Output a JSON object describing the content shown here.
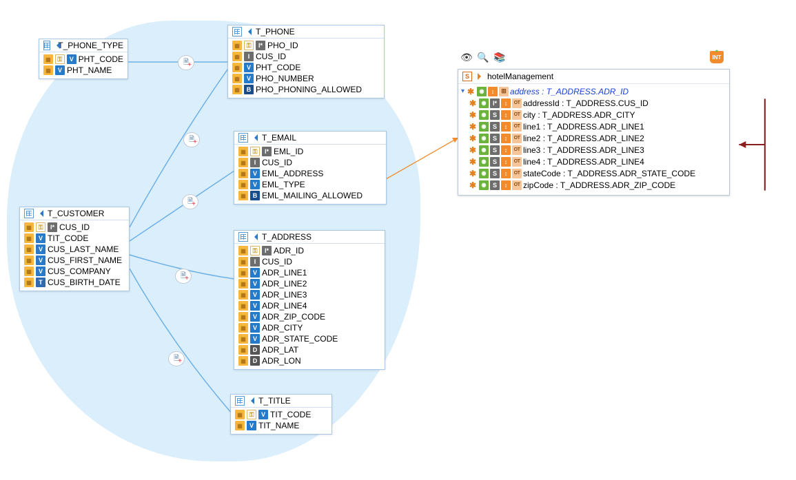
{
  "entities": {
    "phone": {
      "title": "T_PHONE",
      "cols": [
        "PHO_ID",
        "CUS_ID",
        "PHT_CODE",
        "PHO_NUMBER",
        "PHO_PHONING_ALLOWED"
      ],
      "types": [
        "I",
        "I",
        "V",
        "V",
        "B"
      ]
    },
    "phonetype": {
      "title": "T_PHONE_TYPE",
      "cols": [
        "PHT_CODE",
        "PHT_NAME"
      ],
      "types": [
        "V",
        "V"
      ]
    },
    "email": {
      "title": "T_EMAIL",
      "cols": [
        "EML_ID",
        "CUS_ID",
        "EML_ADDRESS",
        "EML_TYPE",
        "EML_MAILING_ALLOWED"
      ],
      "types": [
        "I",
        "I",
        "V",
        "V",
        "B"
      ]
    },
    "address": {
      "title": "T_ADDRESS",
      "cols": [
        "ADR_ID",
        "CUS_ID",
        "ADR_LINE1",
        "ADR_LINE2",
        "ADR_LINE3",
        "ADR_LINE4",
        "ADR_ZIP_CODE",
        "ADR_CITY",
        "ADR_STATE_CODE",
        "ADR_LAT",
        "ADR_LON"
      ],
      "types": [
        "I",
        "I",
        "V",
        "V",
        "V",
        "V",
        "V",
        "V",
        "V",
        "D",
        "D"
      ]
    },
    "customer": {
      "title": "T_CUSTOMER",
      "cols": [
        "CUS_ID",
        "TIT_CODE",
        "CUS_LAST_NAME",
        "CUS_FIRST_NAME",
        "CUS_COMPANY",
        "CUS_BIRTH_DATE"
      ],
      "types": [
        "I",
        "V",
        "V",
        "V",
        "V",
        "T"
      ]
    },
    "title": {
      "title": "T_TITLE",
      "cols": [
        "TIT_CODE",
        "TIT_NAME"
      ],
      "types": [
        "V",
        "V"
      ]
    }
  },
  "panel": {
    "name": "hotelManagement",
    "root": "address : T_ADDRESS.ADR_ID",
    "items": [
      "addressId : T_ADDRESS.CUS_ID",
      "city : T_ADDRESS.ADR_CITY",
      "line1 : T_ADDRESS.ADR_LINE1",
      "line2 : T_ADDRESS.ADR_LINE2",
      "line3 : T_ADDRESS.ADR_LINE3",
      "line4 : T_ADDRESS.ADR_LINE4",
      "stateCode : T_ADDRESS.ADR_STATE_CODE",
      "zipCode : T_ADDRESS.ADR_ZIP_CODE"
    ],
    "itemTypes": [
      "I",
      "S",
      "S",
      "S",
      "S",
      "S",
      "S",
      "S"
    ]
  },
  "toolbar": [
    "👁",
    "🔍",
    "📚"
  ]
}
